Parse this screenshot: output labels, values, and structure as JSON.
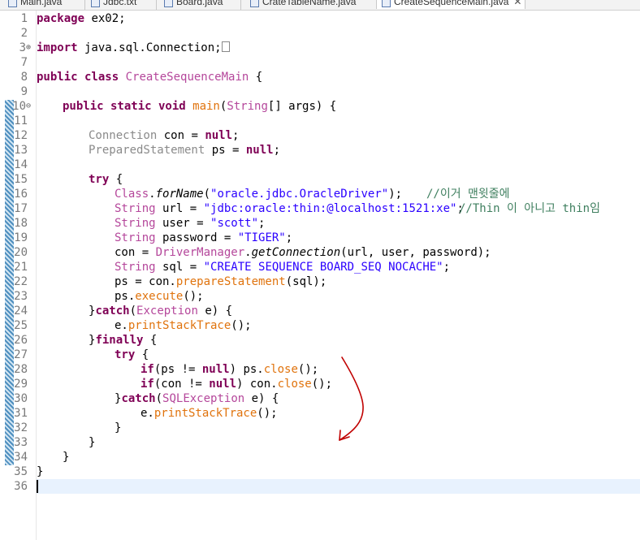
{
  "tabs": [
    {
      "label": "Main.java",
      "active": false
    },
    {
      "label": "Jdbc.txt",
      "active": false
    },
    {
      "label": "Board.java",
      "active": false
    },
    {
      "label": "CrateTableName.java",
      "active": false
    },
    {
      "label": "CreateSequenceMain.java",
      "active": true
    }
  ],
  "close_glyph": "✕",
  "lines": {
    "n1": "1",
    "n2": "2",
    "n3": "3",
    "n7": "7",
    "n8": "8",
    "n9": "9",
    "n10": "10",
    "n11": "11",
    "n12": "12",
    "n13": "13",
    "n14": "14",
    "n15": "15",
    "n16": "16",
    "n17": "17",
    "n18": "18",
    "n19": "19",
    "n20": "20",
    "n21": "21",
    "n22": "22",
    "n23": "23",
    "n24": "24",
    "n25": "25",
    "n26": "26",
    "n27": "27",
    "n28": "28",
    "n29": "29",
    "n30": "30",
    "n31": "31",
    "n32": "32",
    "n33": "33",
    "n34": "34",
    "n35": "35",
    "n36": "36"
  },
  "fold_plus": "⊕",
  "fold_minus": "⊖",
  "code": {
    "l1_kw": "package",
    "l1_rest": " ex02;",
    "l3_kw": "import",
    "l3_rest": " java.sql.Connection;",
    "l8_kw": "public class",
    "l8_name": " CreateSequenceMain",
    "l8_rest": " {",
    "l10_kw": "public static void",
    "l10_main": " main",
    "l10_p1": "(",
    "l10_type": "String",
    "l10_rest": "[] args) {",
    "l12_type": "Connection",
    "l12_mid": " con = ",
    "l12_kw": "null",
    "l12_end": ";",
    "l13_type": "PreparedStatement",
    "l13_mid": " ps = ",
    "l13_kw": "null",
    "l13_end": ";",
    "l15_kw": "try",
    "l15_rest": " {",
    "l16_type": "Class",
    "l16_dot": ".",
    "l16_m": "forName",
    "l16_p": "(",
    "l16_str": "\"oracle.jdbc.OracleDriver\"",
    "l16_end": ");",
    "l16_cm": "//이거 맨윗줄에",
    "l17_type": "String",
    "l17_mid": " url = ",
    "l17_str": "\"jdbc:oracle:thin:@localhost:1521:xe\"",
    "l17_end": ";",
    "l17_cm": "//Thin 이 아니고 thin임",
    "l18_type": "String",
    "l18_mid": " user = ",
    "l18_str": "\"scott\"",
    "l18_end": ";",
    "l19_type": "String",
    "l19_mid": " password = ",
    "l19_str": "\"TIGER\"",
    "l19_end": ";",
    "l20_a": "con = ",
    "l20_type": "DriverManager",
    "l20_dot": ".",
    "l20_m": "getConnection",
    "l20_rest": "(url, user, password);",
    "l21_type": "String",
    "l21_mid": " sql = ",
    "l21_str": "\"CREATE SEQUENCE BOARD_SEQ NOCACHE\"",
    "l21_end": ";",
    "l22_a": "ps = con.",
    "l22_m": "prepareStatement",
    "l22_rest": "(sql);",
    "l23_a": "ps.",
    "l23_m": "execute",
    "l23_rest": "();",
    "l24_a": "}",
    "l24_kw": "catch",
    "l24_p": "(",
    "l24_type": "Exception",
    "l24_rest": " e) {",
    "l25_a": "e.",
    "l25_m": "printStackTrace",
    "l25_rest": "();",
    "l26_a": "}",
    "l26_kw": "finally",
    "l26_rest": " {",
    "l27_kw": "try",
    "l27_rest": " {",
    "l28_kw": "if",
    "l28_a": "(ps != ",
    "l28_kw2": "null",
    "l28_b": ") ps.",
    "l28_m": "close",
    "l28_rest": "();",
    "l29_kw": "if",
    "l29_a": "(con != ",
    "l29_kw2": "null",
    "l29_b": ") con.",
    "l29_m": "close",
    "l29_rest": "();",
    "l30_a": "}",
    "l30_kw": "catch",
    "l30_p": "(",
    "l30_type": "SQLException",
    "l30_rest": " e) {",
    "l31_a": "e.",
    "l31_m": "printStackTrace",
    "l31_rest": "();",
    "l32": "}",
    "l33": "}",
    "l34": "}",
    "l35": "}"
  }
}
